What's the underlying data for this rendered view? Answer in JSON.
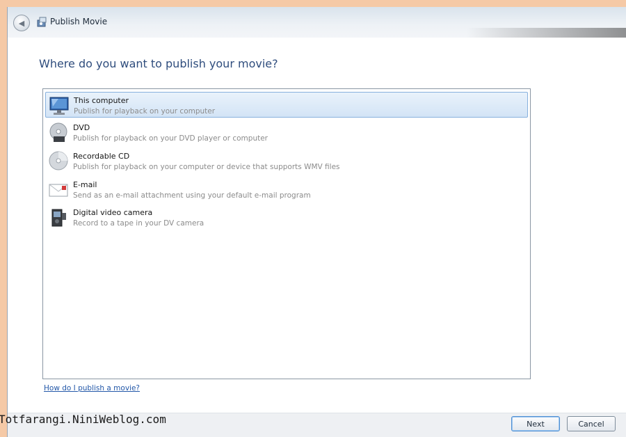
{
  "window": {
    "title": "Publish Movie"
  },
  "heading": "Where do you want to publish your movie?",
  "options": [
    {
      "label": "This computer",
      "description": "Publish for playback on your computer",
      "icon": "computer-icon",
      "selected": true
    },
    {
      "label": "DVD",
      "description": "Publish for playback on your DVD player or computer",
      "icon": "dvd-icon",
      "selected": false
    },
    {
      "label": "Recordable CD",
      "description": "Publish for playback on your computer or device that supports WMV files",
      "icon": "cd-icon",
      "selected": false
    },
    {
      "label": "E-mail",
      "description": "Send as an e-mail attachment using your default e-mail program",
      "icon": "email-icon",
      "selected": false
    },
    {
      "label": "Digital video camera",
      "description": "Record to a tape in your DV camera",
      "icon": "video-camera-icon",
      "selected": false
    }
  ],
  "help_link": "How do I publish a movie?",
  "buttons": {
    "next": "Next",
    "cancel": "Cancel"
  },
  "watermark": "Totfarangi.NiniWeblog.com"
}
